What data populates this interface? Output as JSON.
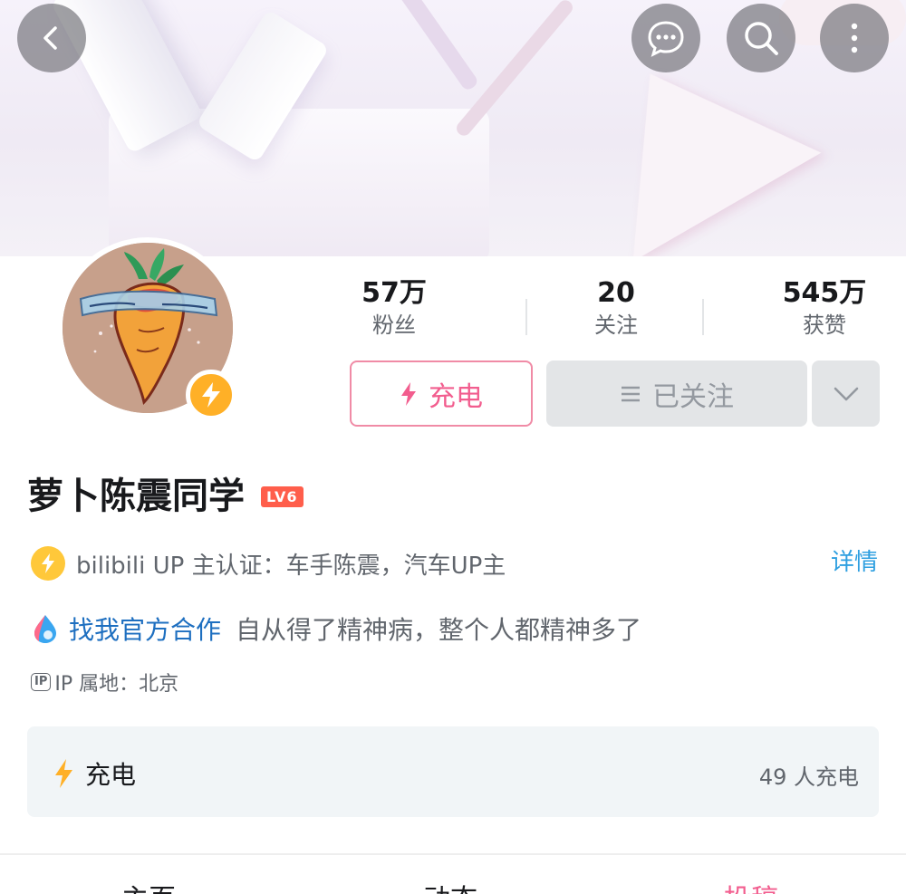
{
  "header": {
    "icons": [
      "back-icon",
      "message-icon",
      "search-icon",
      "more-icon"
    ]
  },
  "profile": {
    "stats": {
      "fans_value": "57万",
      "fans_label": "粉丝",
      "following_value": "20",
      "following_label": "关注",
      "likes_value": "545万",
      "likes_label": "获赞"
    },
    "buttons": {
      "charge_label": "充电",
      "followed_label": "已关注"
    },
    "name": "萝卜陈震同学",
    "level": "LV6",
    "verification": "bilibili UP 主认证：车手陈震，汽车UP主",
    "detail_link": "详情",
    "cooperation_link": "找我官方合作",
    "signature": "自从得了精神病，整个人都精神多了",
    "ip_badge": "IP",
    "ip_location": "IP 属地：北京"
  },
  "charge_panel": {
    "title": "充电",
    "count": "49 人充电"
  },
  "tabs": [
    {
      "label": "主页"
    },
    {
      "label": "动态"
    },
    {
      "label": "投稿"
    }
  ],
  "colors": {
    "accent_pink": "#f25d8e",
    "link_blue": "#2e9fe0",
    "level_badge": "#ff5e4b",
    "badge_gold": "#ffb027"
  }
}
